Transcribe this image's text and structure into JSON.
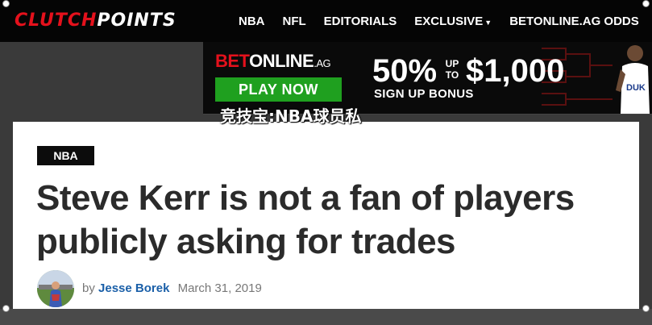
{
  "logo": {
    "part1": "CLUTCH",
    "part2": "POINTS"
  },
  "nav": {
    "items": [
      {
        "label": "NBA",
        "dropdown": false
      },
      {
        "label": "NFL",
        "dropdown": false
      },
      {
        "label": "EDITORIALS",
        "dropdown": false
      },
      {
        "label": "EXCLUSIVE",
        "dropdown": true
      },
      {
        "label": "BETONLINE.AG ODDS",
        "dropdown": false
      }
    ]
  },
  "ad": {
    "brand_bet": "BET",
    "brand_online": "ONLINE",
    "brand_ag": ".AG",
    "cta": "PLAY NOW",
    "percent": "50%",
    "up": "UP",
    "to": "TO",
    "amount": "$1,000",
    "bonus": "SIGN UP BONUS",
    "jersey_text": "DUK"
  },
  "overlay_text": "竞技宝:NBA球员私",
  "article": {
    "category": "NBA",
    "title_line1": "Steve Kerr is not a fan of players",
    "title_line2": "publicly asking for trades",
    "by": "by",
    "author": "Jesse Borek",
    "date": "March 31, 2019"
  },
  "colors": {
    "brand_red": "#e4111c",
    "play_green": "#1fa01f",
    "author_blue": "#1a5fa8"
  }
}
